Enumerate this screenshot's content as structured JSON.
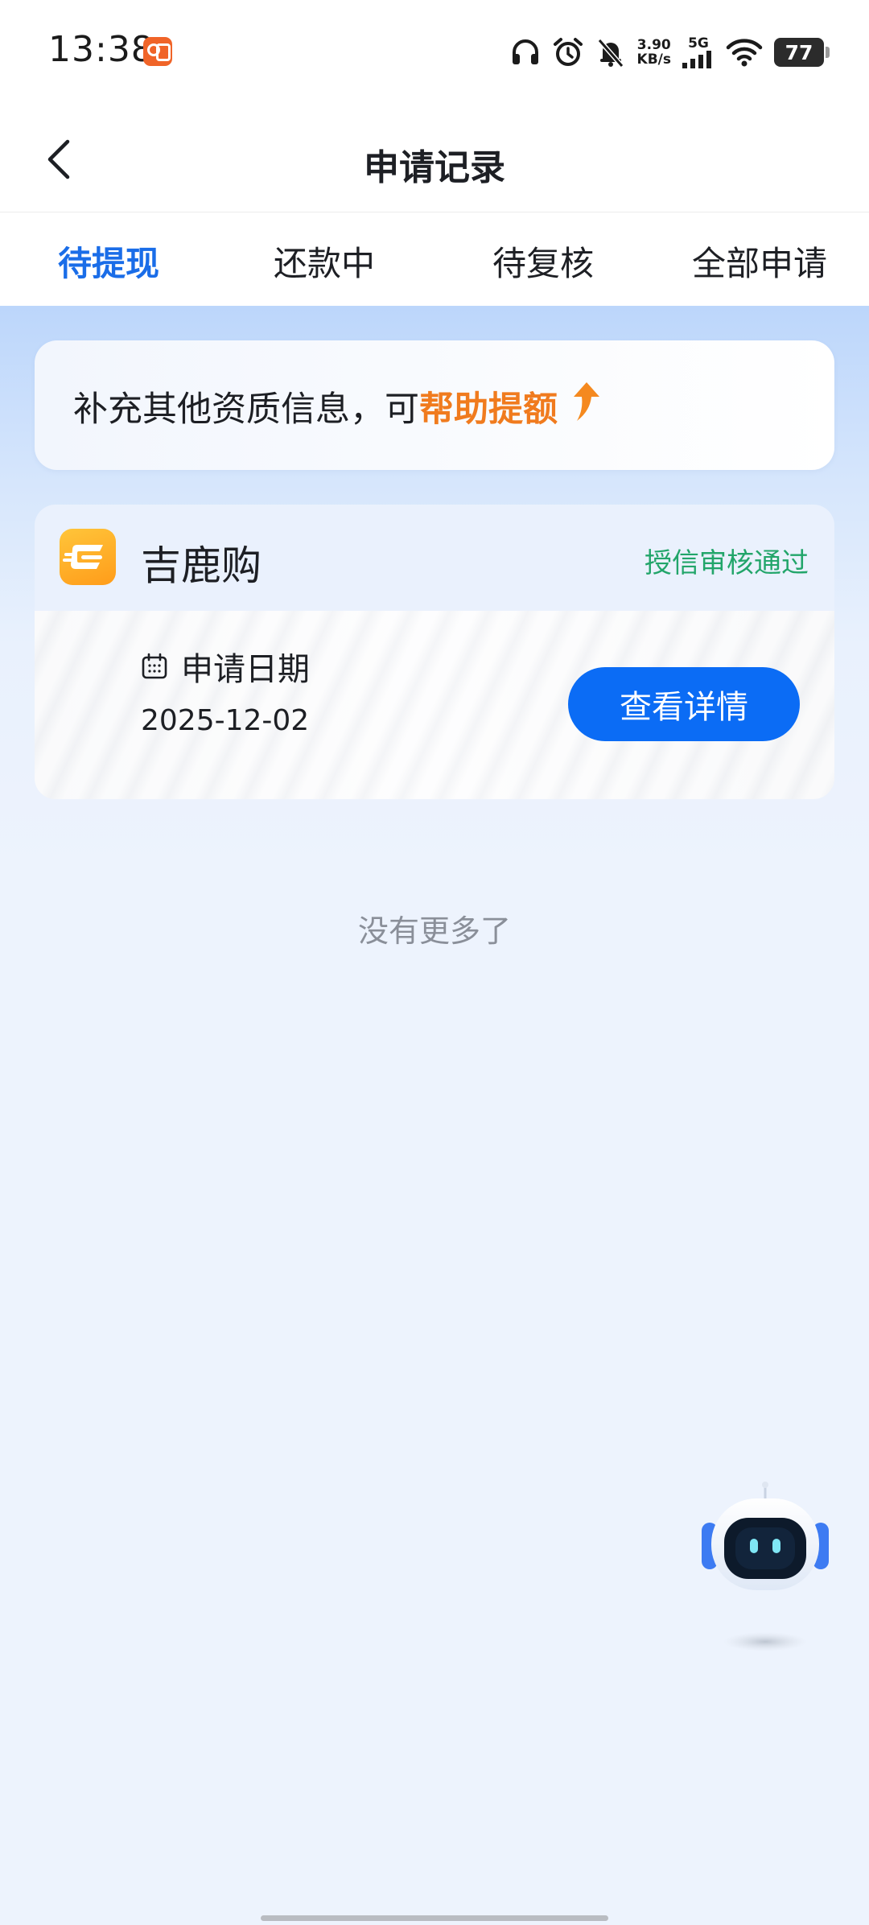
{
  "status_bar": {
    "time": "13:38",
    "net_speed_value": "3.90",
    "net_speed_unit": "KB/s",
    "network_type": "5G",
    "battery": "77"
  },
  "header": {
    "title": "申请记录"
  },
  "tabs": [
    {
      "label": "待提现",
      "active": true
    },
    {
      "label": "还款中",
      "active": false
    },
    {
      "label": "待复核",
      "active": false
    },
    {
      "label": "全部申请",
      "active": false
    }
  ],
  "promo": {
    "text": "补充其他资质信息，可",
    "highlight": "帮助提额"
  },
  "record": {
    "app_name": "吉鹿购",
    "status": "授信审核通过",
    "date_label": "申请日期",
    "date_value": "2025-12-02",
    "detail_button": "查看详情"
  },
  "list_end_text": "没有更多了",
  "colors": {
    "accent": "#1a6de8",
    "button": "#0b6cf5",
    "highlight": "#f07b1e",
    "status_success": "#22a56a"
  }
}
